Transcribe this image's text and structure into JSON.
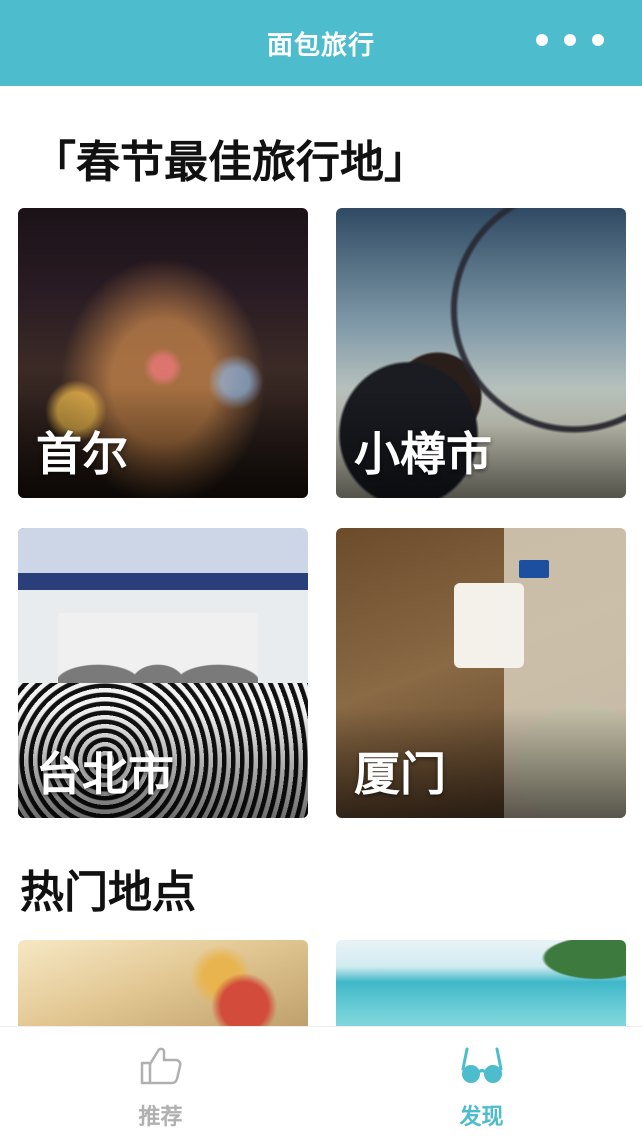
{
  "header": {
    "title": "面包旅行",
    "background_color": "#4dbccc",
    "more_icon": "ellipsis-icon"
  },
  "sections": {
    "featured_title": "「春节最佳旅行地」",
    "popular_title": "热门地点"
  },
  "destinations": [
    {
      "label": "首尔"
    },
    {
      "label": "小樽市"
    },
    {
      "label": "台北市"
    },
    {
      "label": "厦门"
    }
  ],
  "popular_places": [
    {
      "image": "flowers-photo"
    },
    {
      "image": "beach-photo"
    }
  ],
  "tabbar": {
    "tabs": [
      {
        "label": "推荐",
        "icon": "thumbs-up-icon",
        "active": false
      },
      {
        "label": "发现",
        "icon": "glasses-icon",
        "active": true
      }
    ],
    "active_color": "#4dbccc",
    "inactive_color": "#b0b0b0"
  }
}
